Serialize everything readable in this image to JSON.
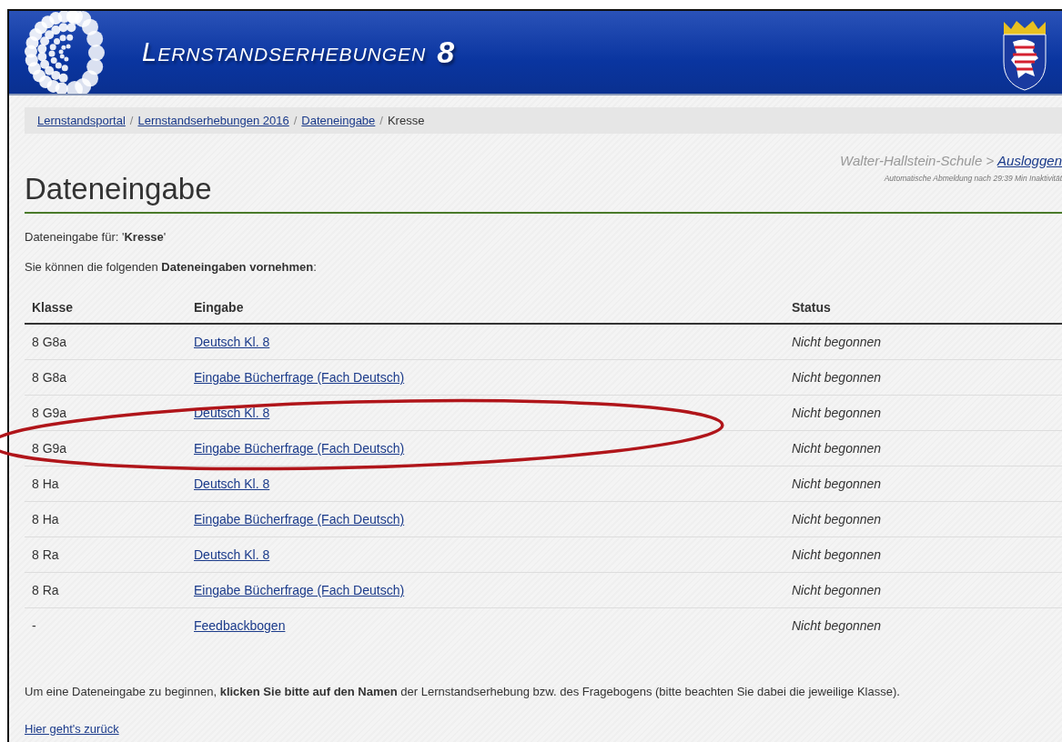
{
  "header": {
    "title": "LERNSTANDSERHEBUNGEN",
    "number": "8"
  },
  "breadcrumb": [
    {
      "label": "Lernstandsportal",
      "link": true,
      "separator": "/"
    },
    {
      "label": "Lernstandserhebungen 2016",
      "link": true,
      "separator": "/"
    },
    {
      "label": "Dateneingabe",
      "link": true,
      "separator": "/"
    },
    {
      "label": "Kresse",
      "link": false
    }
  ],
  "heading": "Dateneingabe",
  "user": {
    "school": "Walter-Hallstein-Schule >",
    "logout": "Ausloggen",
    "timeout": "Automatische Abmeldung nach 29:39 Min Inaktivität"
  },
  "intro": [
    "Dateneingabe für: '**Kresse**'",
    "Sie können die folgenden **Dateneingaben vornehmen**:"
  ],
  "table": {
    "columns": [
      "Klasse",
      "Eingabe",
      "Status"
    ],
    "rows": [
      {
        "klasse": "8 G8a",
        "eingabe": "Deutsch Kl. 8",
        "status": "Nicht begonnen"
      },
      {
        "klasse": "8 G8a",
        "eingabe": "Eingabe Bücherfrage (Fach Deutsch)",
        "status": "Nicht begonnen"
      },
      {
        "klasse": "8 G9a",
        "eingabe": "Deutsch Kl. 8",
        "status": "Nicht begonnen"
      },
      {
        "klasse": "8 G9a",
        "eingabe": "Eingabe Bücherfrage (Fach Deutsch)",
        "status": "Nicht begonnen"
      },
      {
        "klasse": "8 Ha",
        "eingabe": "Deutsch Kl. 8",
        "status": "Nicht begonnen"
      },
      {
        "klasse": "8 Ha",
        "eingabe": "Eingabe Bücherfrage (Fach Deutsch)",
        "status": "Nicht begonnen"
      },
      {
        "klasse": "8 Ra",
        "eingabe": "Deutsch Kl. 8",
        "status": "Nicht begonnen"
      },
      {
        "klasse": "8 Ra",
        "eingabe": "Eingabe Bücherfrage (Fach Deutsch)",
        "status": "Nicht begonnen"
      },
      {
        "klasse": "-",
        "eingabe": "Feedbackbogen",
        "status": "Nicht begonnen"
      }
    ]
  },
  "footer_note": "Um eine Dateneingabe zu beginnen, **klicken Sie bitte auf den Namen** der Lernstandserhebung bzw. des Fragebogens (bitte beachten Sie dabei die jeweilige Klasse).",
  "back_link": "Hier geht's zurück"
}
